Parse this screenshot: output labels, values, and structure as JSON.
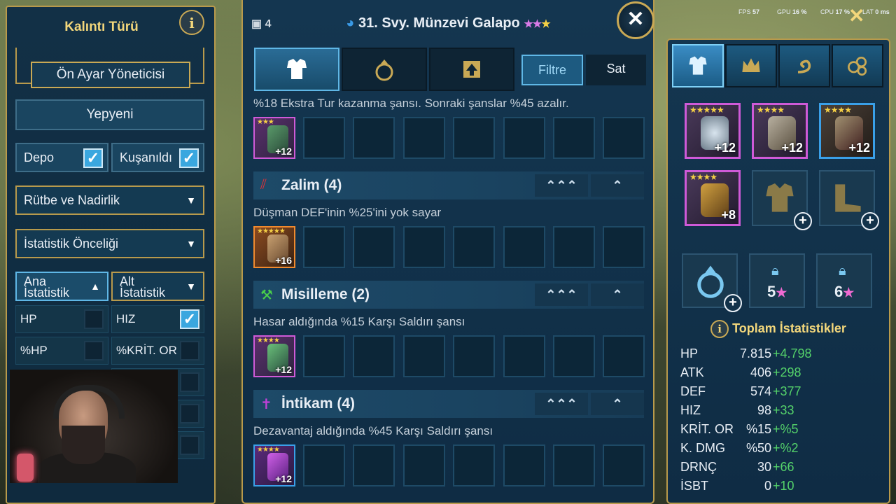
{
  "hud": {
    "fps_label": "FPS",
    "fps": "57",
    "gpu_label": "GPU",
    "gpu": "16 %",
    "cpu_label": "CPU",
    "cpu": "17 %",
    "lat_label": "LAT",
    "lat": "0 ms"
  },
  "left": {
    "title": "Kalıntı Türü",
    "preset_button": "Ön Ayar Yöneticisi",
    "new_button": "Yepyeni",
    "storage_label": "Depo",
    "storage_checked": true,
    "equipped_label": "Kuşanıldı",
    "equipped_checked": true,
    "rank_rarity": "Rütbe ve Nadirlik",
    "stat_priority": "İstatistik Önceliği",
    "main_stat": "Ana İstatistik",
    "sub_stat": "Alt İstatistik",
    "stats": [
      {
        "label": "HP",
        "checked": false
      },
      {
        "label": "HIZ",
        "checked": true
      },
      {
        "label": "%HP",
        "checked": false
      },
      {
        "label": "%KRİT. OR",
        "checked": false
      }
    ]
  },
  "center": {
    "count": "4",
    "champion_title": "31. Svy. Münzevi Galapo",
    "stars": "★★★",
    "filter": "Filtre",
    "sell": "Sat",
    "first_desc": "%18 Ekstra Tur kazanma şansı. Sonraki şanslar %45 azalır.",
    "first_item_level": "+12",
    "sets": [
      {
        "name": "Zalim (4)",
        "desc": "Düşman DEF'inin %25'ini yok sayar",
        "item_level": "+16",
        "icon": "claw-icon",
        "color": "#d8323a",
        "ctrl_a": "⌃⌃⌃",
        "ctrl_b": "⌃"
      },
      {
        "name": "Misilleme (2)",
        "desc": "Hasar aldığında %15 Karşı Saldırı şansı",
        "item_level": "+12",
        "icon": "pickaxe-icon",
        "color": "#4ad04a",
        "ctrl_a": "⌃⌃⌃",
        "ctrl_b": "⌃"
      },
      {
        "name": "İntikam (4)",
        "desc": "Dezavantaj aldığında %45 Karşı Saldırı şansı",
        "item_level": "+12",
        "icon": "dagger-icon",
        "color": "#c040d8",
        "ctrl_a": "⌃⌃⌃",
        "ctrl_b": "⌃"
      }
    ]
  },
  "right": {
    "equipped": [
      {
        "name": "weapon-slot",
        "level": "+12"
      },
      {
        "name": "helmet-slot",
        "level": "+12"
      },
      {
        "name": "shield-slot",
        "level": "+12"
      },
      {
        "name": "gauntlets-slot",
        "level": "+8"
      }
    ],
    "accessory_values": [
      "5",
      "6"
    ],
    "total_stats_title": "Toplam İstatistikler",
    "stats": [
      {
        "name": "HP",
        "value": "7.815",
        "bonus": "+4.798"
      },
      {
        "name": "ATK",
        "value": "406",
        "bonus": "+298"
      },
      {
        "name": "DEF",
        "value": "574",
        "bonus": "+377"
      },
      {
        "name": "HIZ",
        "value": "98",
        "bonus": "+33"
      },
      {
        "name": "KRİT. OR",
        "value": "%15",
        "bonus": "+%5"
      },
      {
        "name": "K. DMG",
        "value": "%50",
        "bonus": "+%2"
      },
      {
        "name": "DRNÇ",
        "value": "30",
        "bonus": "+66"
      },
      {
        "name": "İSBT",
        "value": "0",
        "bonus": "+10"
      }
    ]
  },
  "colors": {
    "gold": "#c9a955",
    "accent": "#3aa7df",
    "bonus_green": "#54d26a"
  }
}
